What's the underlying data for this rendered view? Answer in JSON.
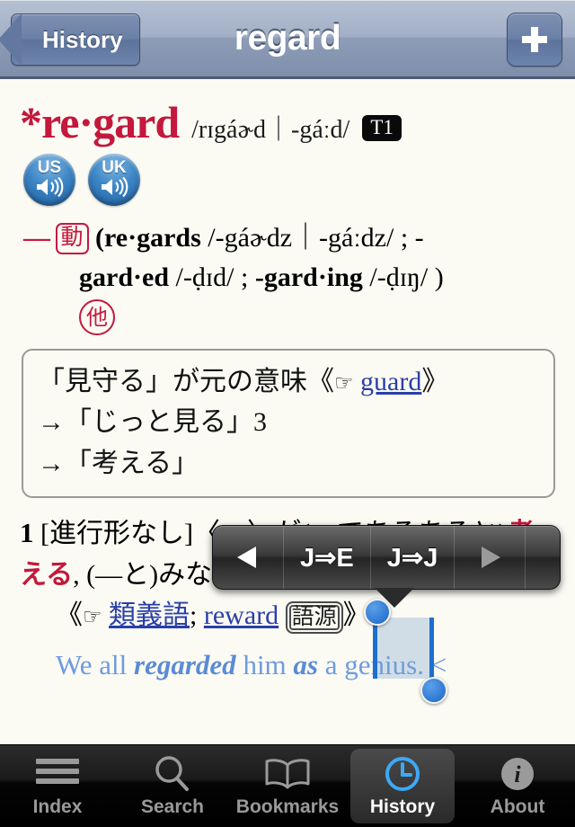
{
  "navbar": {
    "back_label": "History",
    "title": "regard",
    "add_label": "+"
  },
  "entry": {
    "headword": "*re·gard",
    "phonetic": "/rɪgáɚd｜-gáːd/",
    "level_badge": "T1",
    "audio": [
      {
        "label": "US",
        "name": "us-audio-button"
      },
      {
        "label": "UK",
        "name": "uk-audio-button"
      }
    ],
    "verb": {
      "dash": "—",
      "pos_badge": "動",
      "line1": "(re·gards",
      "line1_phon": "/-gáɚdz｜-gáːdz/",
      "line1_tail": "; -",
      "line2_bold": "gard·ed",
      "line2_phon": "/-ḍɪd/",
      "line2_sep": "; ",
      "line2_bold2": "-gard·ing",
      "line2_phon2": "/-ḍɪŋ/",
      "line2_tail": ")",
      "trans_badge": "他"
    },
    "etymology": {
      "line1_pre": "「見守る」が元の意味《",
      "line1_hand": "☞",
      "line1_link": "guard",
      "line1_post": "》",
      "line2": "→「じっと見る」3",
      "line3": "→「考える」"
    },
    "definition": {
      "number": "1",
      "bracket": "[進行形なし]",
      "text_a": "〈…〉が(—である",
      "selected": "ある",
      "text_b": "と)",
      "highlight_a": "考え",
      "highlight_b": "る",
      "text_c": ", (—と)みなす",
      "xref_open": "《",
      "xref_hand": "☞",
      "xref_link1": "類義語",
      "xref_sep": "; ",
      "xref_link2": "reward",
      "xref_badge": "語源",
      "xref_close": "》.",
      "example_pre": "We all ",
      "example_bold1": "regarded",
      "example_mid": " him ",
      "example_bold2": "as",
      "example_post": " a genius. <"
    }
  },
  "popup": {
    "prev_arrow": "◀",
    "item1": "J⇒E",
    "item2": "J⇒J",
    "next_arrow": "▶"
  },
  "tabbar": {
    "tabs": [
      {
        "label": "Index",
        "icon": "hamburger-icon",
        "active": false
      },
      {
        "label": "Search",
        "icon": "magnifier-icon",
        "active": false
      },
      {
        "label": "Bookmarks",
        "icon": "open-book-icon",
        "active": false
      },
      {
        "label": "History",
        "icon": "clock-icon",
        "active": true
      },
      {
        "label": "About",
        "icon": "info-icon",
        "active": false
      }
    ]
  },
  "colors": {
    "crimson": "#c4183c",
    "link_blue": "#2a3fa8",
    "example_blue": "#6e9bdd",
    "nav_blue": "#8d9cb7",
    "selection_blue": "#1d6fd0",
    "page_bg": "#fbfbf4"
  }
}
